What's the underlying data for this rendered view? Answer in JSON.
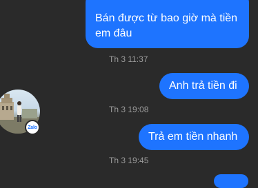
{
  "messages": [
    {
      "text": "Bán được từ bao giờ mà tiền em đâu",
      "time": "Th 3 11:37"
    },
    {
      "text": "Anh trả tiền đi",
      "time": "Th 3 19:08"
    },
    {
      "text": "Trả em tiền nhanh",
      "time": "Th 3 19:45"
    }
  ],
  "avatar": {
    "badge": "Zalo"
  },
  "colors": {
    "background": "#2a2a2a",
    "bubble": "#1e74ff",
    "timestamp": "#9b9b9b"
  }
}
